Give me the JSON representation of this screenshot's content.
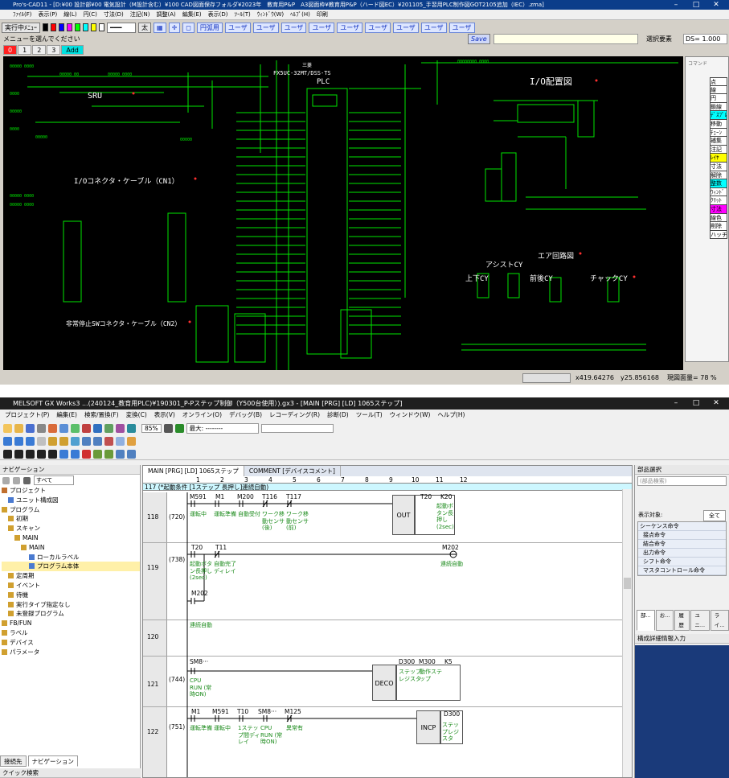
{
  "procad": {
    "title": "Pro's-CAD11 - [D:¥00 設計部¥00 電気設計（M設計含む）¥100 CAD図面保存フォルダ¥2023年　教育用P&P　A3図面枠¥教育用P&P（ハード図EC）¥201105_手習用PLC制作図GOT2105追加（IEC）.zma]",
    "menu": [
      "ﾌｧｲﾙ(F)",
      "表示(P)",
      "線(L)",
      "円(C)",
      "寸法(D)",
      "注記(N)",
      "調整(A)",
      "編集(E)",
      "表示(D)",
      "ﾂｰﾙ(T)",
      "ｳｨﾝﾄﾞｳ(W)",
      "ﾍﾙﾌﾟ(H)",
      "印刷"
    ],
    "run_menu_label": "実行中ﾒﾆｭｰ",
    "line_style_label": "太",
    "quick_buttons": [
      "円弧用",
      "ユーザ",
      "ユーザ",
      "ユーザ",
      "ユーザ",
      "ユーザ",
      "ユーザ",
      "ユーザ",
      "ユーザ",
      "ユーザ"
    ],
    "prompt": "メニューを選んでください",
    "save_label": "Save",
    "select_elem_label": "選択要素",
    "ds_label": "DS= 1.000",
    "layer_tabs": [
      "0",
      "1",
      "2",
      "3",
      "Add"
    ],
    "command_panel_title": "コマンド",
    "command_items": [
      "点",
      "線",
      "円",
      "鎖線",
      "ﾃﾞｽﾌﾟﾚ",
      "移動",
      "ﾁｪｰﾝ",
      "補集",
      "注記",
      "ﾚｲﾔ",
      "寸法",
      "解除",
      "整数",
      "ｳｨﾝﾄﾞ",
      "ｸﾘｯﾄ",
      "寸法",
      "線色",
      "削除",
      "ハッチ"
    ],
    "status_x": "x419.64276",
    "status_y": "y25.856168",
    "status_scale": "現図面量= 78 %",
    "drawing": {
      "sru": "SRU",
      "io_connector": "I/Oコネクタ・ケーブル（CN1）",
      "estop_connector": "非常停止SWコネクタ・ケーブル（CN2）",
      "plc_model": "FX5UC-32MT/DSS-TS",
      "plc_label": "PLC",
      "mitsubishi": "三菱",
      "io_layout": "I/O配置図",
      "air_circuit": "エア回路図",
      "assist_cy": "アシストCY",
      "lift_cy": "上下CY",
      "slide_cy": "前後CY",
      "chuck_cy": "チャックCY"
    }
  },
  "gxworks": {
    "title": "MELSOFT GX Works3 ...(240124_教育用PLC)¥190301_P-Pステップ制御（Y500台使用）).gx3 - [MAIN [PRG] [LD] 1065ステップ]",
    "menu": [
      "プロジェクト(P)",
      "編集(E)",
      "検索/置換(F)",
      "変換(C)",
      "表示(V)",
      "オンライン(O)",
      "デバッグ(B)",
      "レコーディング(R)",
      "診断(D)",
      "ツール(T)",
      "ウィンドウ(W)",
      "ヘルプ(H)"
    ],
    "zoom": "85%",
    "view_target": "最大: --------",
    "navigation": {
      "title": "ナビゲーション",
      "filter": "すべて",
      "tree": [
        {
          "label": "プロジェクト",
          "level": 0
        },
        {
          "label": "ユニット構成図",
          "level": 1
        },
        {
          "label": "プログラム",
          "level": 0
        },
        {
          "label": "初期",
          "level": 1
        },
        {
          "label": "スキャン",
          "level": 1
        },
        {
          "label": "MAIN",
          "level": 2
        },
        {
          "label": "MAIN",
          "level": 3
        },
        {
          "label": "ローカルラベル",
          "level": 4
        },
        {
          "label": "プログラム本体",
          "level": 4,
          "selected": true
        },
        {
          "label": "定周期",
          "level": 1
        },
        {
          "label": "イベント",
          "level": 1
        },
        {
          "label": "待機",
          "level": 1
        },
        {
          "label": "実行タイプ指定なし",
          "level": 1
        },
        {
          "label": "未登録プログラム",
          "level": 1
        },
        {
          "label": "FB/FUN",
          "level": 0
        },
        {
          "label": "ラベル",
          "level": 0
        },
        {
          "label": "デバイス",
          "level": 0
        },
        {
          "label": "パラメータ",
          "level": 0
        }
      ],
      "bottom_tabs": [
        "接続先",
        "ナビゲーション"
      ],
      "quick_search": "クイック検索"
    },
    "editor_tabs": [
      "MAIN [PRG] [LD] 1065ステップ",
      "COMMENT [デバイスコメント]"
    ],
    "columns": [
      "1",
      "2",
      "3",
      "4",
      "5",
      "6",
      "7",
      "8",
      "9",
      "10",
      "11",
      "12"
    ],
    "rung_comment": "117 (*起動条件 [1ステップ 長押し]連続自動)",
    "rungs": [
      {
        "no": "118",
        "step": "(720)",
        "contacts": [
          {
            "dev": "M591",
            "cmt": "運転中"
          },
          {
            "dev": "M1",
            "cmt": "運転準備"
          },
          {
            "dev": "M200",
            "cmt": "自動受付"
          },
          {
            "dev": "T116",
            "cmt": "ワーク移動センサ(後)"
          },
          {
            "dev": "T117",
            "cmt": "ワーク移動センサ(前)"
          }
        ],
        "out_inst": "OUT",
        "out_dev": "T20",
        "out_arg": "K20",
        "out_cmt": "起動ボタン長押し(2sec)"
      },
      {
        "no": "119",
        "step": "(738)",
        "contacts": [
          {
            "dev": "T20",
            "cmt": "起動ボタン長押し(2sec)"
          },
          {
            "dev": "T11",
            "cmt": "自動完了ディレイ"
          },
          {
            "dev": "M202",
            "cmt": ""
          }
        ],
        "coil_dev": "M202",
        "coil_cmt": "連続自動"
      },
      {
        "no": "120",
        "step": "",
        "contacts": [
          {
            "dev": "",
            "cmt": "連続自動"
          }
        ]
      },
      {
        "no": "121",
        "step": "(744)",
        "contacts": [
          {
            "dev": "SM8···",
            "cmt": "CPU RUN (常時ON)"
          }
        ],
        "out_inst": "DECO",
        "out_dev": "D300",
        "out_arg": "M300",
        "out_arg2": "K5",
        "out_cmt": "ステップレジスタ",
        "out_cmt2": "動作ステップ"
      },
      {
        "no": "122",
        "step": "(751)",
        "contacts": [
          {
            "dev": "M1",
            "cmt": "運転準備"
          },
          {
            "dev": "M591",
            "cmt": "運転中"
          },
          {
            "dev": "T10",
            "cmt": "1ステップ間ディレイ"
          },
          {
            "dev": "SM8···",
            "cmt": "CPU RUN (常時ON)"
          },
          {
            "dev": "M125",
            "cmt": "異常有"
          }
        ],
        "out_inst": "INCP",
        "out_dev": "D300",
        "out_cmt": "ステップレジスタ"
      }
    ],
    "parts": {
      "title": "部品選択",
      "search_placeholder": "(部品検索)",
      "display_target_label": "表示対象:",
      "display_target_value": "全て",
      "categories": [
        "シーケンス命令",
        "接点命令",
        "結合命令",
        "出力命令",
        "シフト命令",
        "マスタコントロール命令"
      ],
      "bottom_tabs": [
        "部...",
        "お...",
        "履歴",
        "ユニ...",
        "ライ..."
      ],
      "detail_title": "構成詳細情報入力"
    }
  },
  "colors": {
    "cad_bg": "#000000",
    "cad_green": "#00e600",
    "cad_white": "#ffffff",
    "cad_red": "#ff3030",
    "comment_green": "#1a8a1a",
    "selected_tree": "#fff0a8"
  }
}
